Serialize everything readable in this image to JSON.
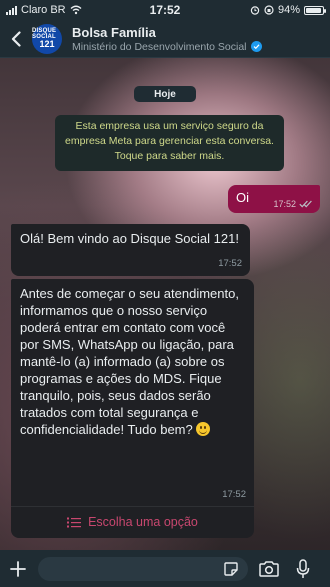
{
  "status_bar": {
    "carrier": "Claro BR",
    "time": "17:52",
    "battery_percent": "94%",
    "battery_level": 0.94
  },
  "header": {
    "avatar_line1": "DISQUE SOCIAL",
    "avatar_line2": "121",
    "contact_name": "Bolsa Família",
    "contact_subtitle": "Ministério do Desenvolvimento Social"
  },
  "chat": {
    "date_chip": "Hoje",
    "system_message": "Esta empresa usa um serviço seguro da empresa Meta para gerenciar esta conversa. Toque para saber mais.",
    "messages": [
      {
        "direction": "out",
        "text": "Oi",
        "time": "17:52",
        "status": "read"
      },
      {
        "direction": "in",
        "text": "Olá! Bem vindo ao Disque Social 121!",
        "time": "17:52"
      },
      {
        "direction": "in",
        "text": "Antes de começar o seu atendimento,  informamos que o nosso serviço poderá entrar em contato com você por SMS, WhatsApp ou ligação, para mantê-lo (a) informado (a) sobre os programas e ações do MDS. Fique tranquilo, pois, seus dados serão tratados com total segurança e confidencialidade! Tudo bem?",
        "time": "17:52",
        "option_label": "Escolha uma opção"
      }
    ]
  },
  "input_bar": {
    "placeholder": ""
  },
  "colors": {
    "header_bg": "#1f2c33",
    "outgoing_bubble": "#8e1146",
    "incoming_bubble": "#1f2024",
    "system_text": "#cfd98a",
    "option_accent": "#c8476f",
    "verified_badge": "#1d9bf0"
  },
  "icons": [
    "back-arrow-icon",
    "verified-icon",
    "read-receipt-icon",
    "list-icon",
    "plus-icon",
    "sticker-icon",
    "camera-icon",
    "microphone-icon",
    "wifi-icon",
    "signal-icon",
    "alarm-icon",
    "battery-icon",
    "smiley-emoji"
  ]
}
